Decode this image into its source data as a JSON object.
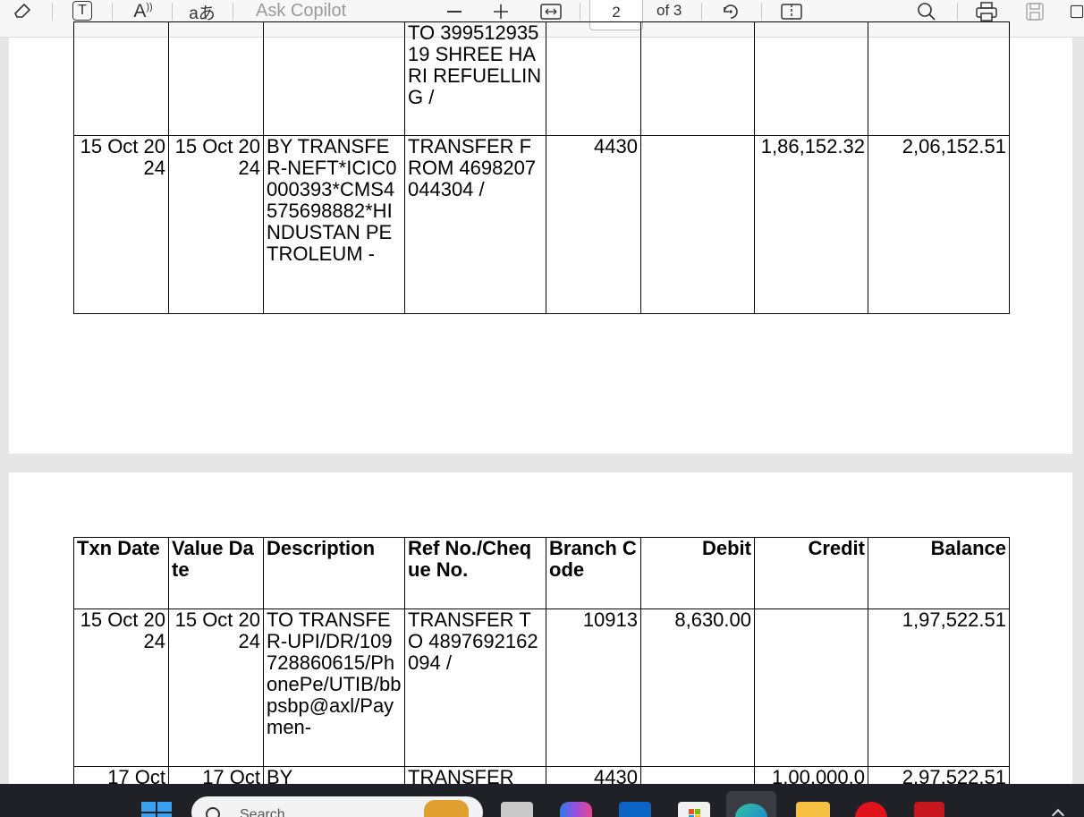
{
  "toolbar": {
    "copilot_placeholder": "Ask Copilot",
    "page_current": "2",
    "page_total": "of 3",
    "icons": [
      "eraser-icon",
      "text-box-icon",
      "read-aloud-icon",
      "translate-icon",
      "zoom-out-icon",
      "zoom-in-icon",
      "fit-width-icon",
      "rotate-icon",
      "page-view-icon",
      "search-icon",
      "print-icon",
      "save-icon",
      "save-as-icon"
    ],
    "icon_labels": {
      "text": "T",
      "read": "A",
      "translate": "aあ"
    }
  },
  "columns": [
    "Txn Date",
    "Value Date",
    "Description",
    "Ref No./Cheque No.",
    "Branch Code",
    "Debit",
    "Credit",
    "Balance"
  ],
  "page1_rows": [
    {
      "txn_date": "",
      "value_date": "",
      "description": "",
      "ref": "TO 39951293519 SHREE HARI REFUELLIN G /",
      "branch": "",
      "debit": "",
      "credit": "",
      "balance": ""
    },
    {
      "txn_date": "15 Oct 2024",
      "value_date": "15 Oct 2024",
      "description": "BY TRANSFER-NEFT*ICIC0000393*CMS4575698882*HINDUSTAN PETROLEUM -",
      "ref": "TRANSFER FROM 4698207044304 /",
      "branch": "4430",
      "debit": "",
      "credit": "1,86,152.32",
      "balance": "2,06,152.51"
    }
  ],
  "page2_rows": [
    {
      "txn_date": "15 Oct 2024",
      "value_date": "15 Oct 2024",
      "description": "TO TRANSFER-UPI/DR/109728860615/PhonePe/UTIB/bbpsbp@axl/Paymen-",
      "ref": "TRANSFER TO 4897692162094 /",
      "branch": "10913",
      "debit": "8,630.00",
      "credit": "",
      "balance": "1,97,522.51"
    },
    {
      "txn_date": "17 Oct",
      "value_date": "17 Oct",
      "description": "BY",
      "ref": "TRANSFER",
      "branch": "4430",
      "debit": "",
      "credit": "1,00,000.0",
      "balance": "2,97,522.51"
    }
  ],
  "taskbar": {
    "search_placeholder": "Search",
    "apps": [
      "windows-start-icon",
      "search-highlight-icon",
      "task-view-icon",
      "copilot-icon",
      "outlook-icon",
      "store-icon",
      "edge-icon",
      "file-explorer-icon",
      "opera-icon",
      "acrobat-icon"
    ]
  },
  "colors": {
    "accent": "#0078d4",
    "page_bg": "#e6e6e6",
    "toolbar_bg": "#f7f7f7",
    "taskbar_bg": "#1f2127"
  }
}
